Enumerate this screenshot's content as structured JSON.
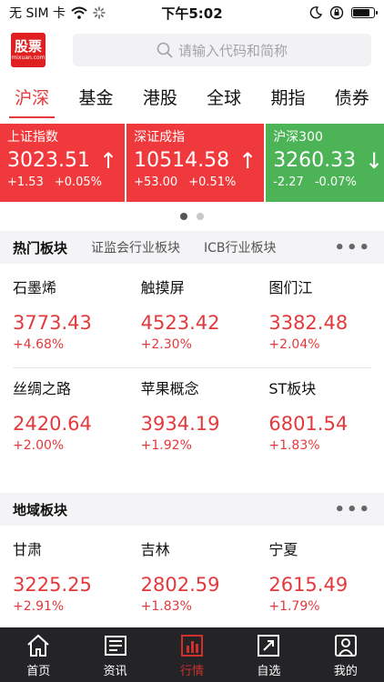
{
  "status_bar": {
    "carrier": "无 SIM 卡",
    "time": "下午5:02",
    "battery_level": 0.85
  },
  "header": {
    "logo_main": "股票",
    "logo_sub": "mixuan.com",
    "search_placeholder": "请输入代码和简称"
  },
  "tabs": [
    {
      "label": "沪深",
      "active": true
    },
    {
      "label": "基金"
    },
    {
      "label": "港股"
    },
    {
      "label": "全球"
    },
    {
      "label": "期指"
    },
    {
      "label": "债券"
    }
  ],
  "index_cards": [
    {
      "name": "上证指数",
      "value": "3023.51",
      "arrow": "↑",
      "change": "+1.53",
      "percent": "+0.05%",
      "color": "#f0393c"
    },
    {
      "name": "深证成指",
      "value": "10514.58",
      "arrow": "↑",
      "change": "+53.00",
      "percent": "+0.51%",
      "color": "#f0393c"
    },
    {
      "name": "沪深300",
      "value": "3260.33",
      "arrow": "↓",
      "change": "-2.27",
      "percent": "-0.07%",
      "color": "#4cb356"
    }
  ],
  "hot_sectors": {
    "title": "热门板块",
    "tabs": [
      "证监会行业板块",
      "ICB行业板块"
    ],
    "more": "•••",
    "items": [
      {
        "name": "石墨烯",
        "value": "3773.43",
        "change": "+4.68%"
      },
      {
        "name": "触摸屏",
        "value": "4523.42",
        "change": "+2.30%"
      },
      {
        "name": "图们江",
        "value": "3382.48",
        "change": "+2.04%"
      },
      {
        "name": "丝绸之路",
        "value": "2420.64",
        "change": "+2.00%"
      },
      {
        "name": "苹果概念",
        "value": "3934.19",
        "change": "+1.92%"
      },
      {
        "name": "ST板块",
        "value": "6801.54",
        "change": "+1.83%"
      }
    ]
  },
  "region_sectors": {
    "title": "地域板块",
    "more": "•••",
    "items": [
      {
        "name": "甘肃",
        "value": "3225.25",
        "change": "+2.91%"
      },
      {
        "name": "吉林",
        "value": "2802.59",
        "change": "+1.83%"
      },
      {
        "name": "宁夏",
        "value": "2615.49",
        "change": "+1.79%"
      }
    ]
  },
  "bottom_nav": [
    {
      "label": "首页",
      "icon": "home-icon"
    },
    {
      "label": "资讯",
      "icon": "news-icon"
    },
    {
      "label": "行情",
      "icon": "market-icon",
      "active": true
    },
    {
      "label": "自选",
      "icon": "watchlist-icon"
    },
    {
      "label": "我的",
      "icon": "profile-icon"
    }
  ],
  "colors": {
    "accent_red": "#e4393c",
    "up_card": "#f0393c",
    "down_card": "#4cb356",
    "nav_bg": "#242427"
  }
}
